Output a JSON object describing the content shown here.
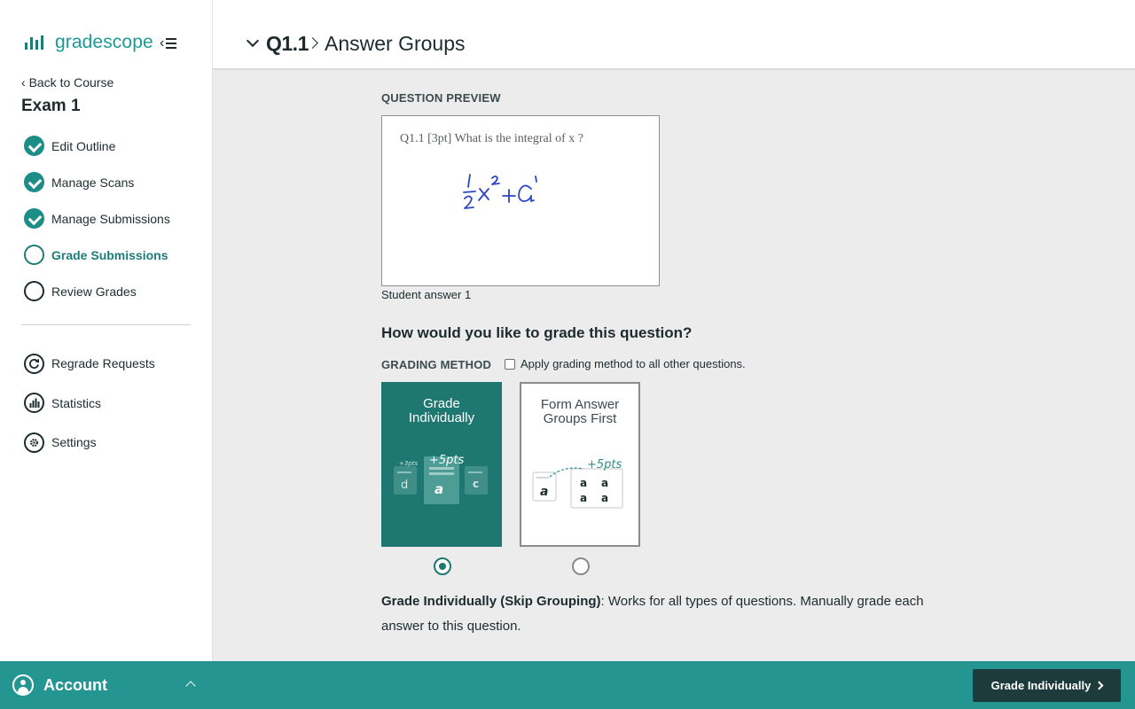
{
  "sidebar": {
    "brand": "gradescope",
    "back_label": "Back to Course",
    "course_title": "Exam 1",
    "steps": [
      {
        "label": "Edit Outline",
        "state": "done"
      },
      {
        "label": "Manage Scans",
        "state": "done"
      },
      {
        "label": "Manage Submissions",
        "state": "done"
      },
      {
        "label": "Grade Submissions",
        "state": "active"
      },
      {
        "label": "Review Grades",
        "state": "todo"
      }
    ],
    "tools": [
      {
        "label": "Regrade Requests",
        "icon": "regrade-icon"
      },
      {
        "label": "Statistics",
        "icon": "statistics-icon"
      },
      {
        "label": "Settings",
        "icon": "gear-icon"
      }
    ],
    "account_label": "Account"
  },
  "header": {
    "question_number": "Q1.1",
    "title": "Answer Groups"
  },
  "preview": {
    "label": "QUESTION PREVIEW",
    "question_text": "Q1.1  [3pt] What is the integral of x ?",
    "caption": "Student answer 1"
  },
  "grading": {
    "question": "How would you like to grade this question?",
    "method_label": "GRADING METHOD",
    "apply_all_label": "Apply grading method to all other questions.",
    "apply_all_checked": false,
    "options": [
      {
        "title_line1": "Grade",
        "title_line2": "Individually",
        "selected": true
      },
      {
        "title_line1": "Form Answer",
        "title_line2": "Groups First",
        "selected": false
      }
    ],
    "description_bold": "Grade Individually (Skip Grouping)",
    "description_rest": ": Works for all types of questions. Manually grade each answer to this question."
  },
  "footer": {
    "primary_label": "Grade Individually"
  },
  "colors": {
    "teal": "#249590",
    "dark_teal": "#1e7770",
    "button_dark": "#1e3b3b"
  }
}
